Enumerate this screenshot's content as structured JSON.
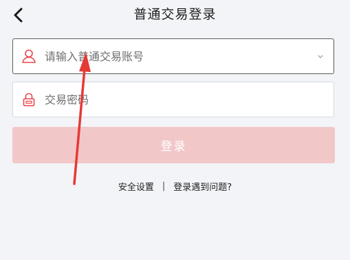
{
  "header": {
    "title": "普通交易登录",
    "back_icon": "chevron-left-icon"
  },
  "form": {
    "account": {
      "placeholder": "请输入普通交易账号",
      "value": "",
      "icon": "user-icon",
      "dropdown_icon": "chevron-down-icon"
    },
    "password": {
      "placeholder": "交易密码",
      "value": "",
      "icon": "lock-icon"
    },
    "login_label": "登录"
  },
  "links": {
    "security": "安全设置",
    "separator": "|",
    "help": "登录遇到问题?"
  },
  "colors": {
    "accent": "#e8474d",
    "login_disabled": "#f2c7c8",
    "annotation_arrow": "#e53935"
  }
}
